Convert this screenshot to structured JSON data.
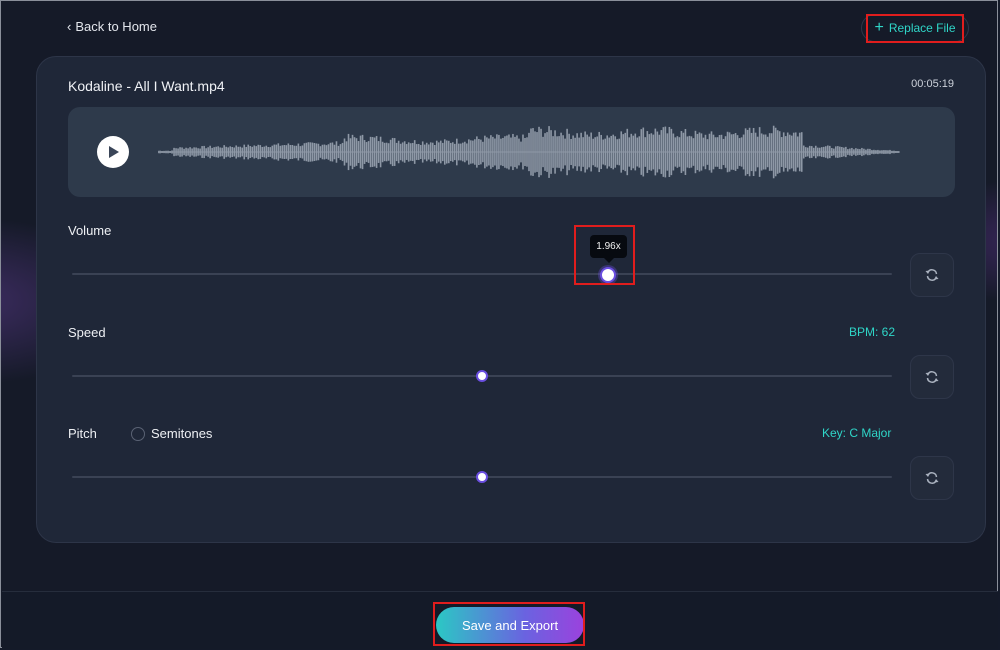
{
  "nav": {
    "back_label": "Back to Home",
    "replace_label": "Replace File"
  },
  "file": {
    "name": "Kodaline - All I Want.mp4",
    "duration": "00:05:19"
  },
  "controls": {
    "volume": {
      "label": "Volume",
      "value_label": "1.96x",
      "level_fraction": 0.654
    },
    "speed": {
      "label": "Speed",
      "bpm_label": "BPM: 62",
      "level_fraction": 0.5
    },
    "pitch": {
      "label": "Pitch",
      "semitones_label": "Semitones",
      "key_label": "Key: C Major",
      "level_fraction": 0.5
    }
  },
  "footer": {
    "save_label": "Save and Export"
  },
  "colors": {
    "accent": "#2fd6c8",
    "thumb_border": "#6a4ee0",
    "waveform": "#8e98a6",
    "highlight": "#e01d1d"
  },
  "icons": [
    "chevron-left-icon",
    "plus-icon",
    "play-icon",
    "refresh-icon"
  ]
}
